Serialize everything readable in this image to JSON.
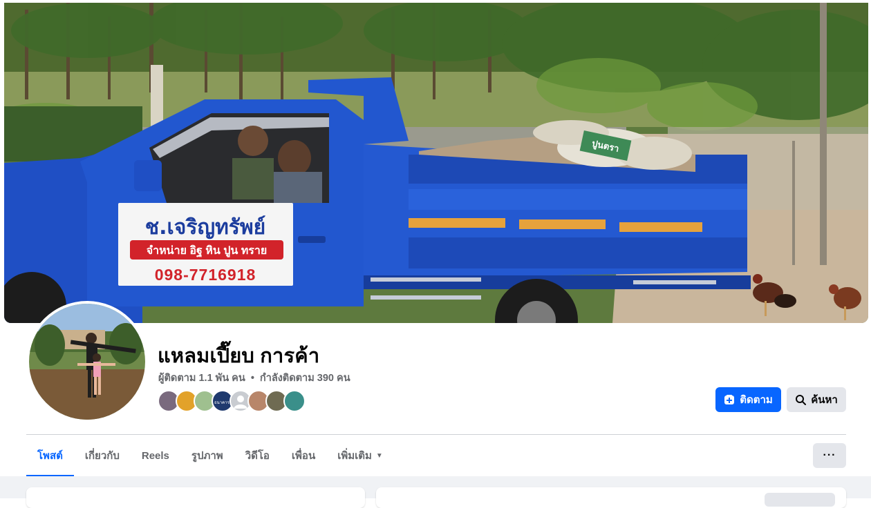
{
  "cover": {
    "truck_sign_name": "ช.เจริญทรัพย์",
    "truck_sign_tagline": "จำหน่าย อิฐ หิน ปูน ทราย",
    "truck_sign_phone": "098-7716918",
    "bag_label": "ปูนตรา"
  },
  "profile": {
    "name": "แหลมเปี๊ยบ การค้า",
    "followers": "ผู้ติดตาม 1.1 พัน คน",
    "separator": "•",
    "following": "กำลังติดตาม 390 คน"
  },
  "follower_avatars": [
    {
      "icon": "avatar-photo",
      "color": "#7a6a7e"
    },
    {
      "icon": "avatar-photo",
      "color": "#e2a22a"
    },
    {
      "icon": "avatar-photo",
      "color": "#9fc08f"
    },
    {
      "icon": "avatar-logo",
      "color": "#1f3a6e",
      "label": "ธนาคาร"
    },
    {
      "icon": "avatar-default",
      "color": "#c9ccd1"
    },
    {
      "icon": "avatar-photo",
      "color": "#b8866a"
    },
    {
      "icon": "avatar-photo",
      "color": "#6f6b52"
    },
    {
      "icon": "avatar-photo",
      "color": "#3a8f8a"
    }
  ],
  "actions": {
    "follow_label": "ติดตาม",
    "search_label": "ค้นหา"
  },
  "tabs": [
    {
      "label": "โพสต์",
      "active": true
    },
    {
      "label": "เกี่ยวกับ"
    },
    {
      "label": "Reels"
    },
    {
      "label": "รูปภาพ"
    },
    {
      "label": "วิดีโอ"
    },
    {
      "label": "เพื่อน"
    },
    {
      "label": "เพิ่มเติม"
    }
  ],
  "more_button": "···",
  "colors": {
    "accent": "#0866ff",
    "secondary_bg": "#e4e6eb",
    "muted_text": "#65676b",
    "truck_blue": "#1f4fc4"
  }
}
